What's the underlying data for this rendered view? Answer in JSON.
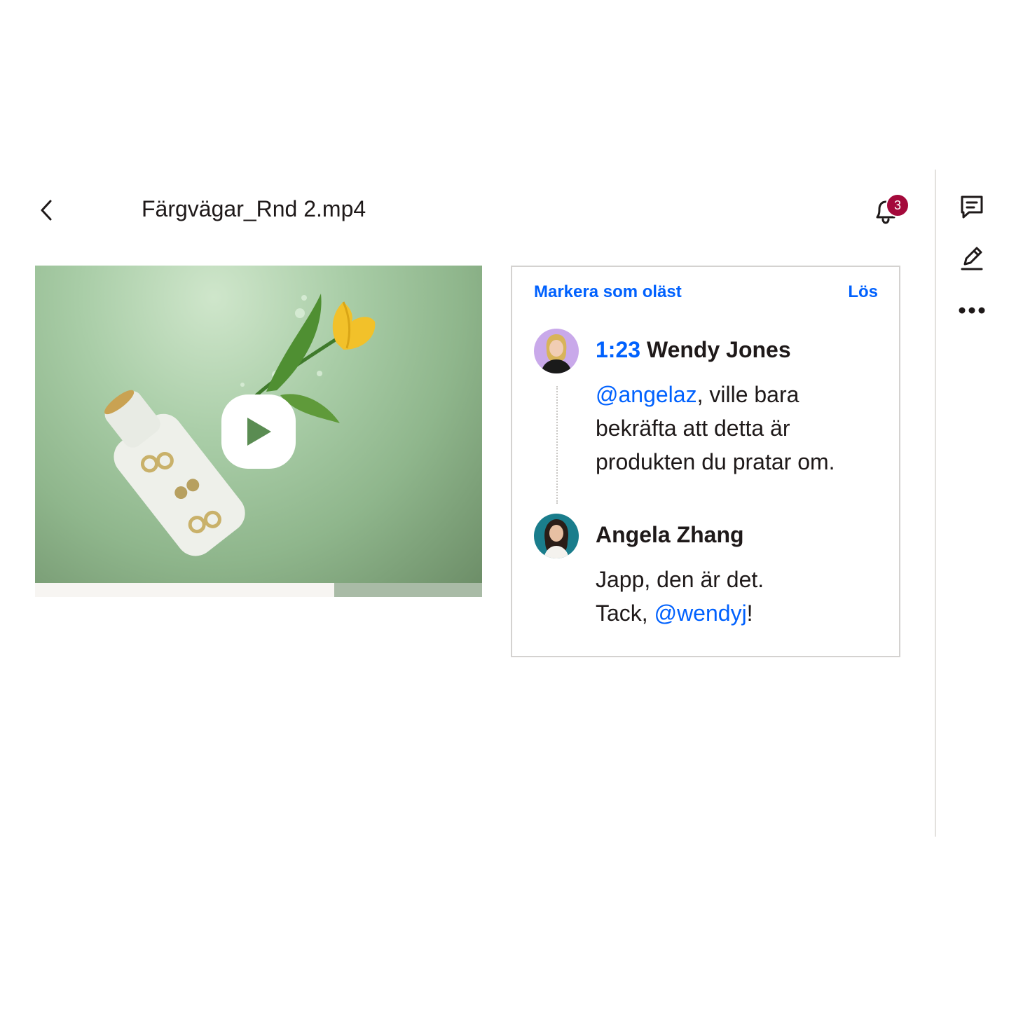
{
  "header": {
    "back_icon": "chevron-left-icon",
    "file_name": "Färgvägar_Rnd 2.mp4",
    "notification_icon": "bell-icon",
    "notification_count": "3"
  },
  "video": {
    "play_icon": "play-icon",
    "progress": 0.67,
    "progress_color": "#f7f5f2",
    "track_color": "#a9bba6"
  },
  "comment_panel": {
    "mark_unread_label": "Markera som oläst",
    "resolve_label": "Lös",
    "comments": [
      {
        "timestamp": "1:23",
        "author": "Wendy Jones",
        "mention": "@angelaz",
        "text_after_mention": ", ville bara",
        "line2": "bekräfta att detta är",
        "line3": "produkten du pratar om."
      },
      {
        "author": "Angela Zhang",
        "line1": "Japp, den är det.",
        "line2_prefix": "Tack, ",
        "mention": "@wendyj",
        "line2_suffix": "!"
      }
    ]
  },
  "sidebar": {
    "items": [
      {
        "icon": "comment-icon"
      },
      {
        "icon": "pencil-icon"
      },
      {
        "icon": "more-icon"
      }
    ]
  },
  "colors": {
    "accent": "#0061fe",
    "badge": "#a4093b",
    "text": "#1e1919"
  }
}
